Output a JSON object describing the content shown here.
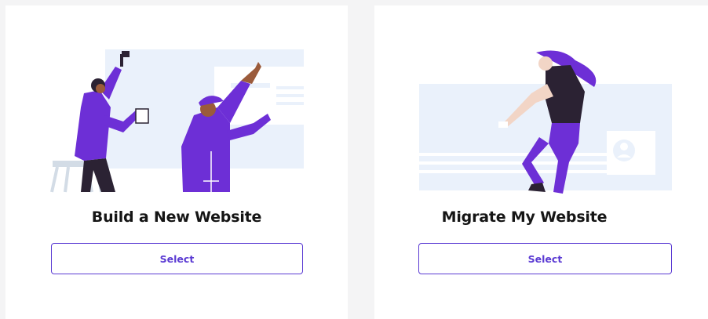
{
  "options": [
    {
      "title": "Build a New Website",
      "button_label": "Select",
      "illustration": "painters-building-website"
    },
    {
      "title": "Migrate My Website",
      "button_label": "Select",
      "illustration": "woman-moving-website-block"
    }
  ],
  "colors": {
    "accent": "#5b3bd3",
    "illustration_purple": "#6d2fd6",
    "panel_blue": "#eaf1fb",
    "background": "#f4f4f5",
    "card": "#ffffff"
  }
}
